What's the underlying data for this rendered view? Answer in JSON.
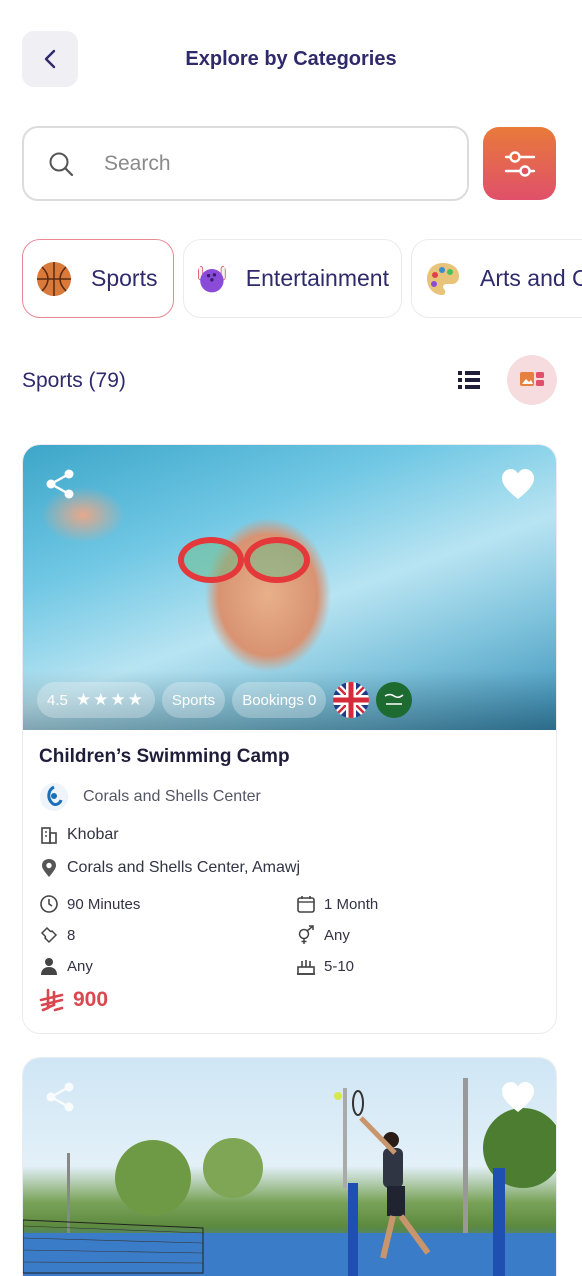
{
  "header": {
    "title": "Explore by Categories"
  },
  "search": {
    "placeholder": "Search",
    "value": ""
  },
  "categories": [
    {
      "label": "Sports",
      "icon": "basketball-icon",
      "active": true
    },
    {
      "label": "Entertainment",
      "icon": "bowling-icon",
      "active": false
    },
    {
      "label": "Arts and Cr",
      "icon": "palette-icon",
      "active": false
    }
  ],
  "list": {
    "title": "Sports (79)"
  },
  "cards": [
    {
      "title": "Children’s Swimming Camp",
      "rating": "4.5",
      "stars": "★★★★",
      "category_badge": "Sports",
      "bookings_badge": "Bookings 0",
      "provider": "Corals and Shells Center",
      "city": "Khobar",
      "location": "Corals and Shells Center, Amawj",
      "duration": "90 Minutes",
      "period": "1 Month",
      "sessions": "8",
      "gender": "Any",
      "audience": "Any",
      "age": "5-10",
      "price": "900"
    },
    {
      "title": "",
      "image": "tennis"
    }
  ],
  "colors": {
    "accent_gradient_start": "#e87a3a",
    "accent_gradient_end": "#e0506a",
    "title_color": "#2e2a6b",
    "price_color": "#d9474f"
  }
}
